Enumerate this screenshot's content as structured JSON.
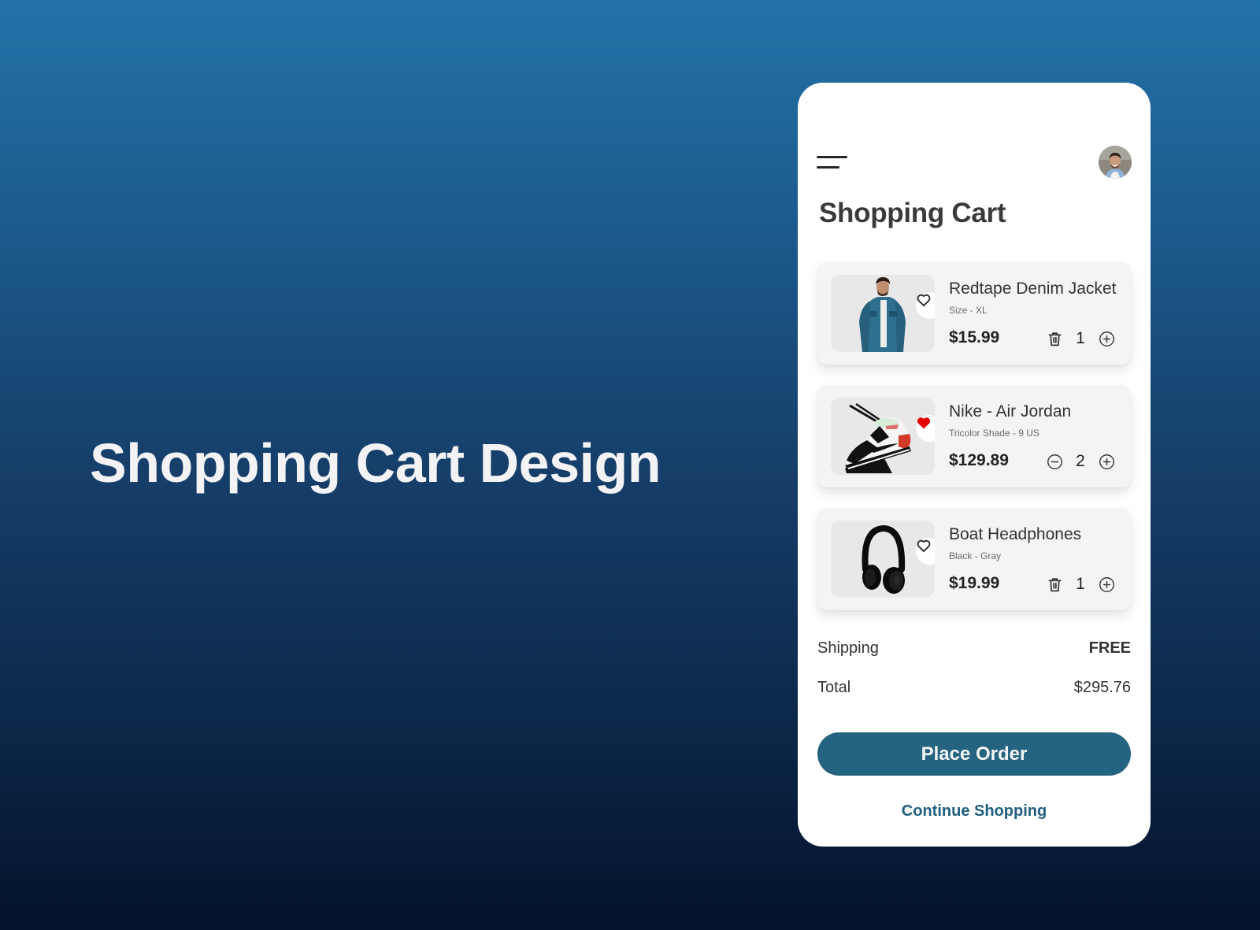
{
  "headline": "Shopping Cart Design",
  "app": {
    "title": "Shopping Cart",
    "menu_icon": "hamburger-menu-icon",
    "avatar": "user-avatar"
  },
  "items": [
    {
      "name": "Redtape Denim Jacket",
      "variant": "Size - XL",
      "price": "$15.99",
      "quantity": "1",
      "favorited": false,
      "decrement_icon": "trash-icon",
      "increment_icon": "plus-circle-icon",
      "image": "denim-jacket-model"
    },
    {
      "name": "Nike - Air Jordan",
      "variant": "Tricolor Shade - 9 US",
      "price": "$129.89",
      "quantity": "2",
      "favorited": true,
      "decrement_icon": "minus-circle-icon",
      "increment_icon": "plus-circle-icon",
      "image": "air-jordan-sneaker"
    },
    {
      "name": "Boat Headphones",
      "variant": "Black - Gray",
      "price": "$19.99",
      "quantity": "1",
      "favorited": false,
      "decrement_icon": "trash-icon",
      "increment_icon": "plus-circle-icon",
      "image": "black-headphones"
    }
  ],
  "summary": {
    "shipping_label": "Shipping",
    "shipping_value": "FREE",
    "total_label": "Total",
    "total_value": "$295.76"
  },
  "actions": {
    "place_order": "Place Order",
    "continue_shopping": "Continue Shopping"
  },
  "colors": {
    "background_top": "#2372a8",
    "background_bottom": "#04122b",
    "primary_button": "#246480",
    "link": "#1f5f7d",
    "favorite_active": "#e60000",
    "card": "#f4f4f4"
  }
}
